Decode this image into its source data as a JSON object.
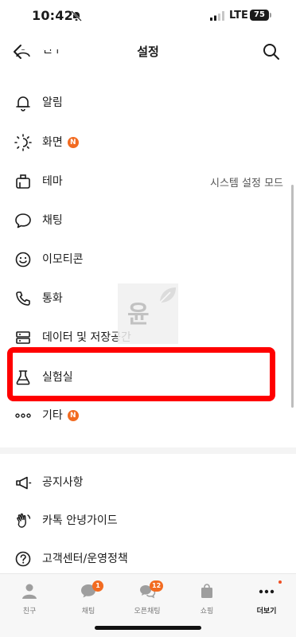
{
  "status_bar": {
    "time": "10:42",
    "network": "LTE",
    "battery": "75"
  },
  "nav": {
    "title": "설정"
  },
  "rows": [
    {
      "label": "친구",
      "icon": "person-icon"
    },
    {
      "label": "알림",
      "icon": "bell-icon"
    },
    {
      "label": "화면",
      "badge": "N",
      "icon": "sun-icon"
    },
    {
      "label": "테마",
      "value": "시스템 설정 모드",
      "icon": "theme-icon"
    },
    {
      "label": "채팅",
      "icon": "chat-bubble-icon"
    },
    {
      "label": "이모티콘",
      "icon": "emoticon-icon"
    },
    {
      "label": "통화",
      "icon": "phone-icon"
    },
    {
      "label": "데이터 및 저장공간",
      "icon": "storage-icon"
    },
    {
      "label": "실험실",
      "icon": "flask-icon"
    },
    {
      "label": "기타",
      "badge": "N",
      "icon": "more-dots-icon"
    },
    {
      "label": "공지사항",
      "icon": "megaphone-icon"
    },
    {
      "label": "카톡 안녕가이드",
      "icon": "wave-hand-icon"
    },
    {
      "label": "고객센터/운영정책",
      "icon": "help-icon"
    }
  ],
  "watermark": {
    "text": "윤"
  },
  "tabs": [
    {
      "label": "친구",
      "icon": "person-icon"
    },
    {
      "label": "채팅",
      "badge": "1",
      "icon": "chat-bubble-icon"
    },
    {
      "label": "오픈채팅",
      "badge": "12",
      "icon": "open-chat-icon"
    },
    {
      "label": "쇼핑",
      "icon": "shopping-bag-icon"
    },
    {
      "label": "더보기",
      "icon": "more-dots-icon",
      "active": true
    }
  ],
  "colors": {
    "badge": "#f26b21",
    "highlight": "#ff0000"
  }
}
